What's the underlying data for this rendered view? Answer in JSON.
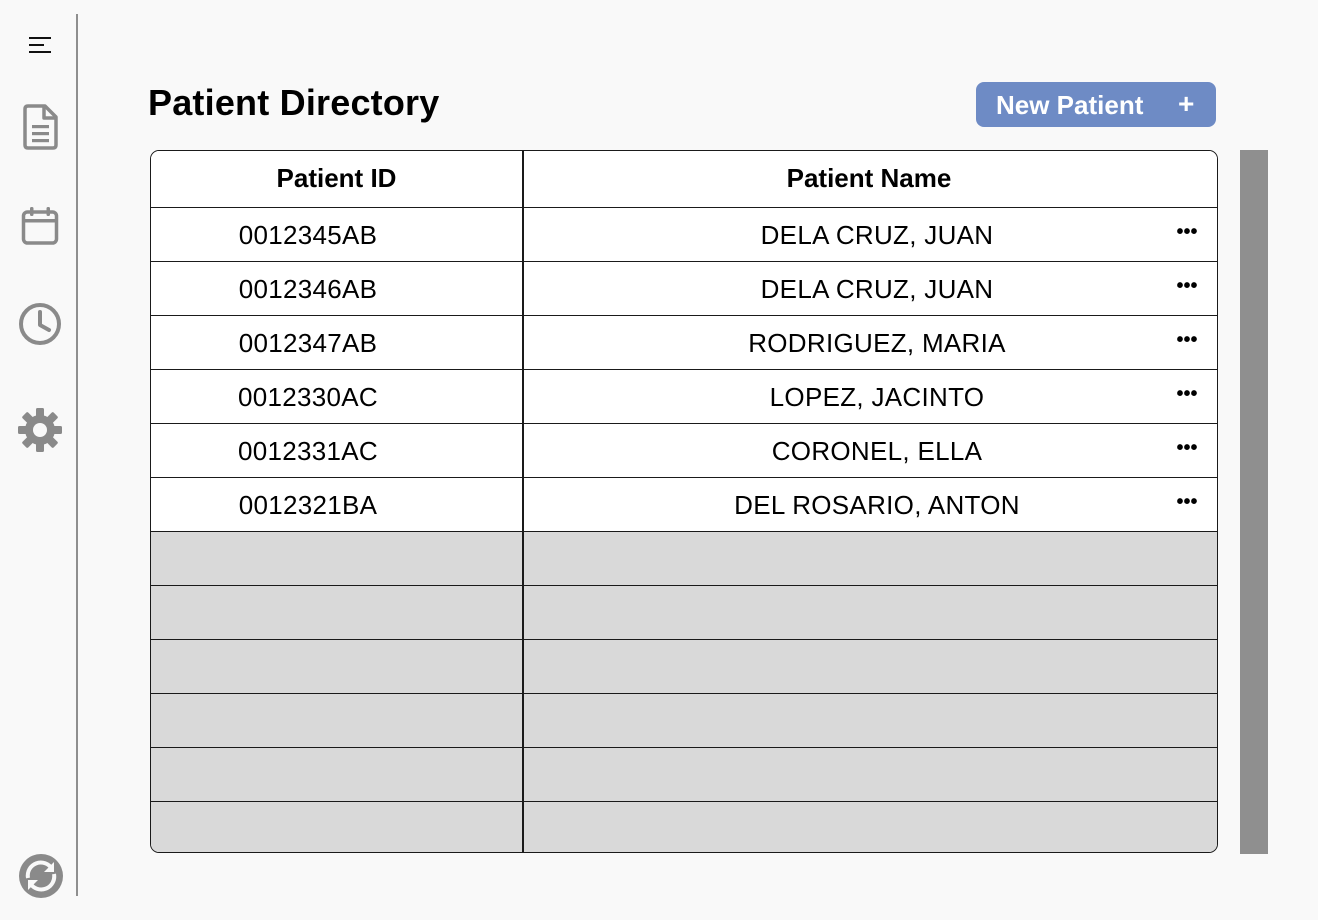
{
  "sidebar": {
    "icons": [
      "menu-icon",
      "document-icon",
      "calendar-icon",
      "clock-icon",
      "gear-icon",
      "sync-icon"
    ]
  },
  "header": {
    "title": "Patient Directory",
    "new_button_label": "New Patient",
    "new_button_icon": "+"
  },
  "table": {
    "columns": [
      "Patient ID",
      "Patient Name"
    ],
    "rows": [
      {
        "id": "0012345AB",
        "name": "DELA CRUZ, JUAN"
      },
      {
        "id": "0012346AB",
        "name": "DELA CRUZ, JUAN"
      },
      {
        "id": "0012347AB",
        "name": "RODRIGUEZ, MARIA"
      },
      {
        "id": "0012330AC",
        "name": "LOPEZ, JACINTO"
      },
      {
        "id": "0012331AC",
        "name": "CORONEL, ELLA"
      },
      {
        "id": "0012321BA",
        "name": "DEL ROSARIO, ANTON"
      }
    ],
    "row_menu_label": "•••",
    "empty_rows": 6
  },
  "colors": {
    "accent": "#6e8bc5",
    "empty_row": "#d9d9d9",
    "scrollbar": "#8f8f8f",
    "icon": "#8a8a8a"
  }
}
